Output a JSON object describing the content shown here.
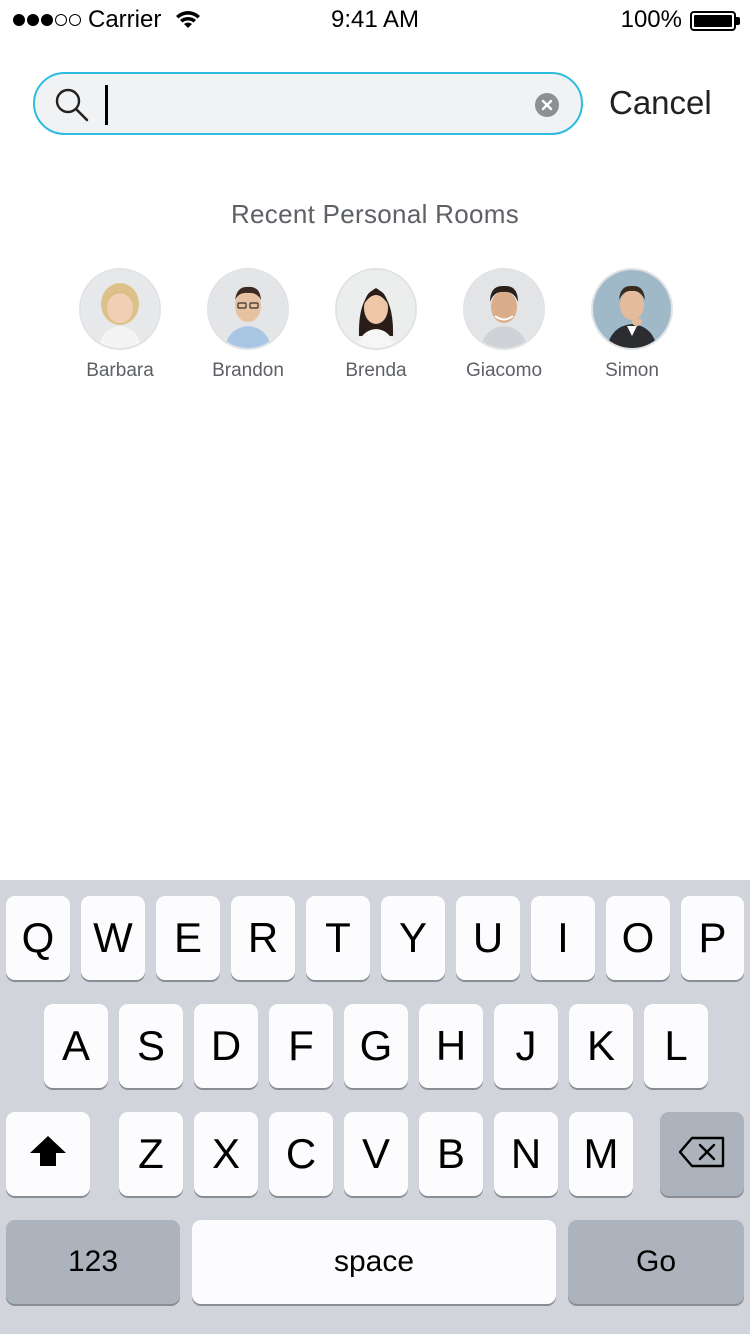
{
  "status_bar": {
    "carrier": "Carrier",
    "time": "9:41 AM",
    "battery": "100%",
    "signal_bars_filled": 3,
    "signal_bars_total": 5
  },
  "search": {
    "value": "",
    "placeholder": "",
    "cancel_label": "Cancel",
    "accent_color": "#2dbbe0"
  },
  "recent_rooms": {
    "title": "Recent Personal Rooms",
    "people": [
      {
        "name": "Barbara"
      },
      {
        "name": "Brandon"
      },
      {
        "name": "Brenda"
      },
      {
        "name": "Giacomo"
      },
      {
        "name": "Simon"
      }
    ]
  },
  "keyboard": {
    "row1": [
      "Q",
      "W",
      "E",
      "R",
      "T",
      "Y",
      "U",
      "I",
      "O",
      "P"
    ],
    "row2": [
      "A",
      "S",
      "D",
      "F",
      "G",
      "H",
      "J",
      "K",
      "L"
    ],
    "row3": [
      "Z",
      "X",
      "C",
      "V",
      "B",
      "N",
      "M"
    ],
    "shift_icon": "shift-icon",
    "backspace_icon": "backspace-icon",
    "numbers_label": "123",
    "space_label": "space",
    "go_label": "Go"
  }
}
